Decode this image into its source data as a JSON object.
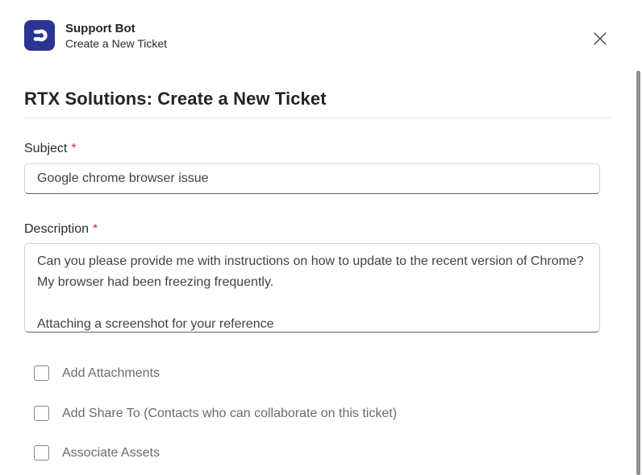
{
  "header": {
    "app_name": "Support Bot",
    "subtitle": "Create a New Ticket"
  },
  "form": {
    "title": "RTX Solutions: Create a New Ticket",
    "subject": {
      "label": "Subject",
      "required_marker": "*",
      "value": "Google chrome browser issue"
    },
    "description": {
      "label": "Description",
      "required_marker": "*",
      "value": "Can you please provide me with instructions on how to update to the recent version of Chrome? My browser had been freezing frequently.\n\nAttaching a screenshot for your reference"
    },
    "checkboxes": [
      {
        "label": "Add Attachments",
        "checked": false
      },
      {
        "label": "Add Share To (Contacts who can collaborate on this ticket)",
        "checked": false
      },
      {
        "label": "Associate Assets",
        "checked": false
      }
    ]
  },
  "icons": {
    "app_logo": "support-bot-d-logo",
    "close": "close-x"
  },
  "colors": {
    "app_icon_bg": "#2a3492",
    "required_red": "#c13349",
    "title_text": "#252423",
    "muted_text": "#6b6b6b",
    "input_border": "#d1d1d1",
    "input_border_bottom": "#616161",
    "scrollbar": "#8f8f8f"
  }
}
